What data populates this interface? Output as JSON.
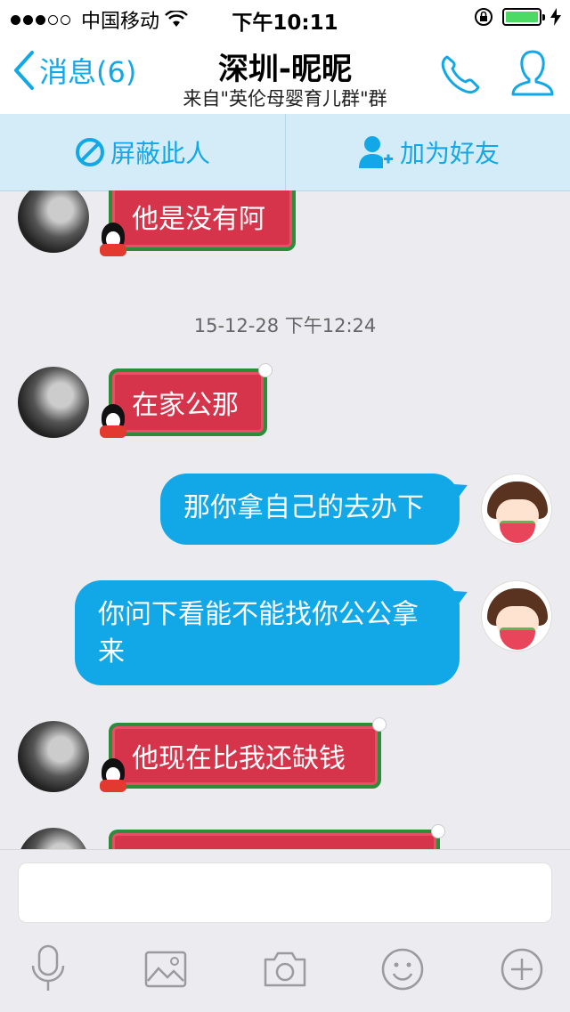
{
  "status": {
    "carrier": "中国移动",
    "time": "下午10:11"
  },
  "nav": {
    "back_label": "消息(6)",
    "title": "深圳-昵昵",
    "subtitle": "来自\"英伦母婴育儿群\"群"
  },
  "actions": {
    "block_label": "屏蔽此人",
    "add_friend_label": "加为好友"
  },
  "messages": [
    {
      "side": "other",
      "text": "他是没有阿"
    },
    {
      "side": "other",
      "text": "在家公那"
    },
    {
      "side": "me",
      "text": "那你拿自己的去办下"
    },
    {
      "side": "me",
      "text": "你问下看能不能找你公公拿来"
    },
    {
      "side": "other",
      "text": "他现在比我还缺钱"
    },
    {
      "side": "other",
      "text": ""
    }
  ],
  "timestamp": "15-12-28 下午12:24",
  "input": {
    "value": ""
  },
  "colors": {
    "accent": "#12a8e8",
    "bubble_red": "#d5344b",
    "bubble_border": "#2e8b3a"
  }
}
